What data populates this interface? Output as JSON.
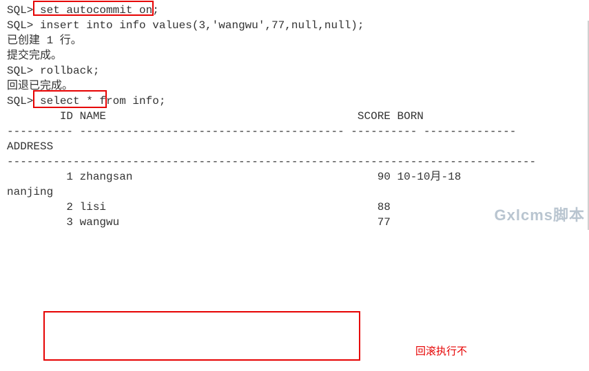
{
  "lines": {
    "l1_prompt": "SQL> ",
    "l1_cmd": "set autocommit on;",
    "l2_prompt": "SQL> ",
    "l2_cmd": "insert into info values(3,'wangwu',77,null,null);",
    "blank": "",
    "l4": "已创建 1 行。",
    "l6": "提交完成。",
    "l7_prompt": "SQL> ",
    "l7_cmd": "rollback;",
    "l9": "回退已完成。",
    "l11": "SQL> select * from info;",
    "hdr": "        ID NAME                                      SCORE BORN",
    "sep1": "---------- ---------------------------------------- ---------- --------------",
    "addr": "ADDRESS",
    "sep2": "--------------------------------------------------------------------------------",
    "r1a": "         1 zhangsan                                     90 10-10月-18",
    "r1b": "nanjing",
    "r2": "         2 lisi                                         88",
    "r3": "         3 wangwu                                       77"
  },
  "annotation": "回滚执行不",
  "watermark": "Gxlcms脚本"
}
